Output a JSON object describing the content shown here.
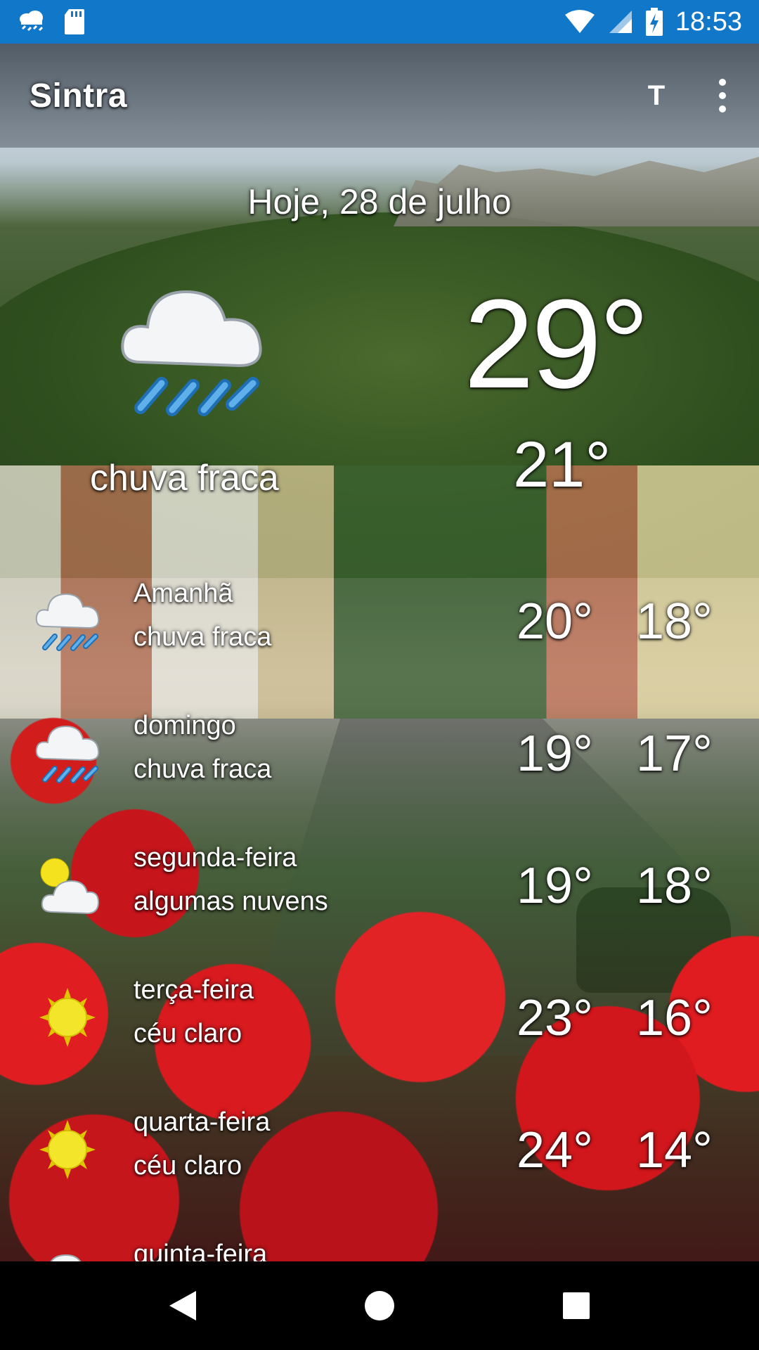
{
  "status_bar": {
    "time": "18:53",
    "left_icons": [
      "weather-rain-icon",
      "sd-card-icon"
    ],
    "right_icons": [
      "wifi-icon",
      "signal-icon",
      "battery-charging-icon"
    ],
    "background_color": "#1177c9"
  },
  "app_bar": {
    "title": "Sintra",
    "units_label": "T",
    "overflow_icon": "more-vert-icon"
  },
  "today": {
    "date": "Hoje, 28 de julho",
    "temp": "29°",
    "low": "21°",
    "description": "chuva fraca",
    "icon": "light-rain-icon"
  },
  "forecast": [
    {
      "day": "Amanhã",
      "desc": "chuva fraca",
      "hi": "20°",
      "lo": "18°",
      "icon": "light-rain-icon"
    },
    {
      "day": "domingo",
      "desc": "chuva fraca",
      "hi": "19°",
      "lo": "17°",
      "icon": "light-rain-icon"
    },
    {
      "day": "segunda-feira",
      "desc": "algumas nuvens",
      "hi": "19°",
      "lo": "18°",
      "icon": "partly-cloudy-icon"
    },
    {
      "day": "terça-feira",
      "desc": "céu claro",
      "hi": "23°",
      "lo": "16°",
      "icon": "sun-icon"
    },
    {
      "day": "quarta-feira",
      "desc": "céu claro",
      "hi": "24°",
      "lo": "14°",
      "icon": "sun-icon"
    },
    {
      "day": "quinta-feira",
      "desc": "",
      "hi": "",
      "lo": "",
      "icon": "cloud-icon"
    }
  ],
  "nav_bar": {
    "buttons": [
      "back-icon",
      "home-icon",
      "recents-icon"
    ]
  }
}
